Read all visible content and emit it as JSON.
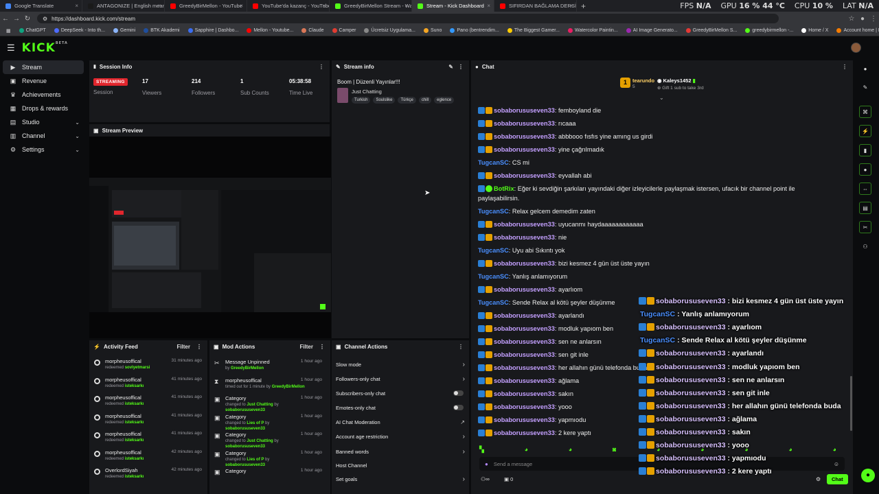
{
  "browser": {
    "tabs": [
      {
        "label": "Google Translate",
        "color": "#4285f4"
      },
      {
        "label": "ANTAGONIZE | English meaning -",
        "color": "#1a1a1a"
      },
      {
        "label": "GreedyBirMellon - YouTube",
        "color": "#ff0000"
      },
      {
        "label": "YouTube'da kazanç - YouTube Stu",
        "color": "#ff0000"
      },
      {
        "label": "GreedyBirMellon Stream - Watch",
        "color": "#53fc18"
      },
      {
        "label": "Stream - Kick Dashboard",
        "color": "#53fc18"
      },
      {
        "label": "SIFIRDAN BAĞLAMA DERSİ 3 (EN",
        "color": "#ff0000"
      }
    ],
    "active_tab": 5,
    "url": "https://dashboard.kick.com/stream",
    "perf": {
      "fps_label": "FPS",
      "fps": "N/A",
      "gpu_label": "GPU",
      "gpu": "16 % 44 °C",
      "cpu_label": "CPU",
      "cpu": "10 %",
      "lat_label": "LAT",
      "lat": "N/A"
    },
    "bookmarks": [
      {
        "label": "ChatGPT",
        "color": "#10a37f"
      },
      {
        "label": "DeepSeek - Into th...",
        "color": "#4d6bfe"
      },
      {
        "label": "Gemini",
        "color": "#8ab4f8"
      },
      {
        "label": "BTK Akademi",
        "color": "#1f4e9c"
      },
      {
        "label": "Sapphire | Dashbo...",
        "color": "#3a6df0"
      },
      {
        "label": "Mellon - Youtube...",
        "color": "#ff0000"
      },
      {
        "label": "Claude",
        "color": "#d97757"
      },
      {
        "label": "Camper",
        "color": "#e03c31"
      },
      {
        "label": "Ücretsiz Uygulama...",
        "color": "#888"
      },
      {
        "label": "Suno",
        "color": "#f5a623"
      },
      {
        "label": "Pano (bentrendim...",
        "color": "#3399ff"
      },
      {
        "label": "The Biggest Gamer...",
        "color": "#ffcc00"
      },
      {
        "label": "Watercolor Paintin...",
        "color": "#e91e63"
      },
      {
        "label": "AI Image Generato...",
        "color": "#9c27b0"
      },
      {
        "label": "GreedyBirMellon S...",
        "color": "#e53935"
      },
      {
        "label": "greedybirmellon -...",
        "color": "#53fc18"
      },
      {
        "label": "Home / X",
        "color": "#ffffff"
      },
      {
        "label": "Account home | Ba...",
        "color": "#f57c00"
      }
    ]
  },
  "kick": {
    "logo": "KICK",
    "logo_sup": "BETA"
  },
  "sidebar": {
    "items": [
      {
        "label": "Stream",
        "icon": "video-icon",
        "glyph": "▶",
        "chev": ""
      },
      {
        "label": "Revenue",
        "icon": "wallet-icon",
        "glyph": "▣",
        "chev": ""
      },
      {
        "label": "Achievements",
        "icon": "trophy-icon",
        "glyph": "♛",
        "chev": ""
      },
      {
        "label": "Drops & rewards",
        "icon": "gift-icon",
        "glyph": "▦",
        "chev": ""
      },
      {
        "label": "Studio",
        "icon": "studio-icon",
        "glyph": "▤",
        "chev": "⌄"
      },
      {
        "label": "Channel",
        "icon": "channel-icon",
        "glyph": "▥",
        "chev": "⌄"
      },
      {
        "label": "Settings",
        "icon": "gear-icon",
        "glyph": "⚙",
        "chev": "⌄"
      }
    ]
  },
  "session": {
    "title": "Session Info",
    "badge": "STREAMING",
    "badge_label": "Session",
    "stats": [
      {
        "value": "17",
        "label": "Viewers"
      },
      {
        "value": "214",
        "label": "Followers"
      },
      {
        "value": "1",
        "label": "Sub Counts"
      },
      {
        "value": "05:38:58",
        "label": "Time Live"
      }
    ]
  },
  "stream_info": {
    "title": "Stream info",
    "stream_title": "Boom | Düzenli Yayınlar!!!",
    "category": "Just Chatting",
    "tags": [
      "Turkish",
      "Soulslike",
      "Türkçe",
      "chill",
      "eglence"
    ]
  },
  "preview": {
    "title": "Stream Preview"
  },
  "activity": {
    "title": "Activity Feed",
    "filter": "Filter",
    "items": [
      {
        "name": "morpheusoffical",
        "time": "31 minutes ago",
        "action": "redeemed",
        "reward": "sovlyetmarsi"
      },
      {
        "name": "morpheusoffical",
        "time": "41 minutes ago",
        "action": "redeemed",
        "reward": "isteksarkı"
      },
      {
        "name": "morpheusoffical",
        "time": "41 minutes ago",
        "action": "redeemed",
        "reward": "isteksarkı"
      },
      {
        "name": "morpheusoffical",
        "time": "41 minutes ago",
        "action": "redeemed",
        "reward": "isteksarkı"
      },
      {
        "name": "morpheusoffical",
        "time": "41 minutes ago",
        "action": "redeemed",
        "reward": "isteksarkı"
      },
      {
        "name": "morpheusoffical",
        "time": "42 minutes ago",
        "action": "redeemed",
        "reward": "isteksarkı"
      },
      {
        "name": "OverlordSiyah",
        "time": "42 minutes ago",
        "action": "redeemed",
        "reward": "isteksarkı"
      }
    ]
  },
  "mod": {
    "title": "Mod Actions",
    "filter": "Filter",
    "items": [
      {
        "name": "Message Unpinned",
        "time": "1 hour ago",
        "sub1": "by ",
        "hl1": "GreedyBirMellon",
        "sub2": "",
        "hl2": "",
        "glyph": "✂"
      },
      {
        "name": "morpheusoffical",
        "time": "1 hour ago",
        "sub1": "timed out for 1 minute by ",
        "hl1": "GreedyBirMellon",
        "sub2": "",
        "hl2": "",
        "glyph": "⧗"
      },
      {
        "name": "Category",
        "time": "1 hour ago",
        "sub1": "changed to ",
        "hl1": "Just Chatting",
        "sub2": " by ",
        "hl2": "sobaborususeven33",
        "glyph": "▣"
      },
      {
        "name": "Category",
        "time": "1 hour ago",
        "sub1": "changed to ",
        "hl1": "Lies of P",
        "sub2": " by ",
        "hl2": "sobaborususeven33",
        "glyph": "▣"
      },
      {
        "name": "Category",
        "time": "1 hour ago",
        "sub1": "changed to ",
        "hl1": "Just Chatting",
        "sub2": " by ",
        "hl2": "sobaborususeven33",
        "glyph": "▣"
      },
      {
        "name": "Category",
        "time": "1 hour ago",
        "sub1": "changed to ",
        "hl1": "Lies of P",
        "sub2": " by ",
        "hl2": "sobaborususeven33",
        "glyph": "▣"
      },
      {
        "name": "Category",
        "time": "1 hour ago",
        "sub1": "",
        "hl1": "",
        "sub2": "",
        "hl2": "",
        "glyph": "▣"
      }
    ]
  },
  "channel_actions": {
    "title": "Channel Actions",
    "items": [
      {
        "label": "Slow mode",
        "ctrl": "arrow"
      },
      {
        "label": "Followers-only chat",
        "ctrl": "arrow"
      },
      {
        "label": "Subscribers-only chat",
        "ctrl": "toggle"
      },
      {
        "label": "Emotes-only chat",
        "ctrl": "toggle"
      },
      {
        "label": "AI Chat Moderation",
        "ctrl": "ext"
      },
      {
        "label": "Account age restriction",
        "ctrl": "arrow"
      },
      {
        "label": "Banned words",
        "ctrl": "arrow"
      },
      {
        "label": "Host Channel",
        "ctrl": "none"
      },
      {
        "label": "Set goals",
        "ctrl": "arrow"
      }
    ]
  },
  "chat": {
    "title": "Chat",
    "leader1": "tearundo",
    "leader1_count": "5",
    "leader2": "Kaleys1452",
    "leader2_sub": "Gift 1 sub to take 3rd",
    "messages": [
      {
        "user": "sobaborususeven33",
        "text": "femboyland die",
        "type": 1
      },
      {
        "user": "sobaborususeven33",
        "text": "rıcaaa",
        "type": 1
      },
      {
        "user": "sobaborususeven33",
        "text": "abbbooo fısfıs yine amıng us girdi",
        "type": 1
      },
      {
        "user": "sobaborususeven33",
        "text": "yine çağrılmadık",
        "type": 1
      },
      {
        "user": "TugcanSC",
        "text": "CS mi",
        "type": 2
      },
      {
        "user": "sobaborususeven33",
        "text": "eyvallah abi",
        "type": 1
      },
      {
        "user": "BotRix",
        "text": "Eğer ki sevdiğin şarkıları yayındaki diğer izleyicilerle paylaşmak istersen, ufacık bir channel point ile",
        "text2": "paylaşabilirsin.",
        "type": 3
      },
      {
        "user": "TugcanSC",
        "text": "Relax gelcem demedim zaten",
        "type": 2
      },
      {
        "user": "sobaborususeven33",
        "text": "uyucanmı haydaaaaaaaaaaaa",
        "type": 1
      },
      {
        "user": "sobaborususeven33",
        "text": "nie",
        "type": 1
      },
      {
        "user": "TugcanSC",
        "text": "Uyu abi Sıkıntı yok",
        "type": 2
      },
      {
        "user": "sobaborususeven33",
        "text": "bizi kesmez 4 gün üst üste yayın",
        "type": 1
      },
      {
        "user": "TugcanSC",
        "text": "Yanlış anlamıyorum",
        "type": 2
      },
      {
        "user": "sobaborususeven33",
        "text": "ayarlıom",
        "type": 1
      },
      {
        "user": "TugcanSC",
        "text": "Sende Relax al kötü şeyler düşünme",
        "type": 2
      },
      {
        "user": "sobaborususeven33",
        "text": "ayarlandı",
        "type": 1
      },
      {
        "user": "sobaborususeven33",
        "text": "modluk yapıom ben",
        "type": 1
      },
      {
        "user": "sobaborususeven33",
        "text": "sen ne anlarsın",
        "type": 1
      },
      {
        "user": "sobaborususeven33",
        "text": "sen git inle",
        "type": 1
      },
      {
        "user": "sobaborususeven33",
        "text": "her allahın günü telefonda buda",
        "type": 1
      },
      {
        "user": "sobaborususeven33",
        "text": "ağlama",
        "type": 1
      },
      {
        "user": "sobaborususeven33",
        "text": "sakın",
        "type": 1
      },
      {
        "user": "sobaborususeven33",
        "text": "yooo",
        "type": 1
      },
      {
        "user": "sobaborususeven33",
        "text": "yapmıodu",
        "type": 1
      },
      {
        "user": "sobaborususeven33",
        "text": "2 kere yaptı",
        "type": 1
      }
    ],
    "overlay": [
      {
        "user": "sobaborususeven33",
        "text": "bizi kesmez 4 gün üst üste yayın",
        "type": 1
      },
      {
        "user": "TugcanSC",
        "text": "Yanlış anlamıyorum",
        "type": 2
      },
      {
        "user": "sobaborususeven33",
        "text": "ayarlıom",
        "type": 1
      },
      {
        "user": "TugcanSC",
        "text": "Sende Relax al kötü şeyler düşünme",
        "type": 2
      },
      {
        "user": "sobaborususeven33",
        "text": "ayarlandı",
        "type": 1
      },
      {
        "user": "sobaborususeven33",
        "text": "modluk yapıom ben",
        "type": 1
      },
      {
        "user": "sobaborususeven33",
        "text": "sen ne anlarsın",
        "type": 1
      },
      {
        "user": "sobaborususeven33",
        "text": "sen git inle",
        "type": 1
      },
      {
        "user": "sobaborususeven33",
        "text": "her allahın günü telefonda buda",
        "type": 1
      },
      {
        "user": "sobaborususeven33",
        "text": "ağlama",
        "type": 1
      },
      {
        "user": "sobaborususeven33",
        "text": "sakın",
        "type": 1
      },
      {
        "user": "sobaborususeven33",
        "text": "yooo",
        "type": 1
      },
      {
        "user": "sobaborususeven33",
        "text": "yapmıodu",
        "type": 1
      },
      {
        "user": "sobaborususeven33",
        "text": "2 kere yaptı",
        "type": 1
      }
    ],
    "input_placeholder": "Send a message",
    "points": "0",
    "send": "Chat"
  },
  "colors": {
    "accent": "#53fc18",
    "live": "#e1262d",
    "panel": "#18191c"
  }
}
